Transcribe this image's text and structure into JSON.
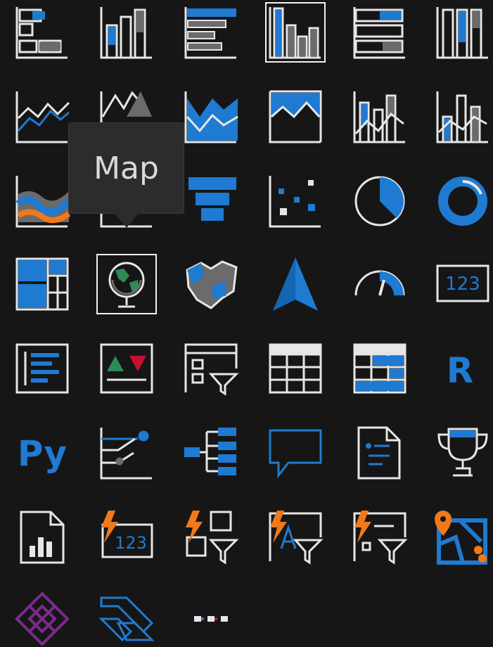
{
  "tooltip": {
    "text": "Map"
  },
  "colors": {
    "background": "#161616",
    "icon_line": "#e6e6e6",
    "accent_blue": "#1f7ad1",
    "gray": "#6b6b6b",
    "orange": "#f0791c",
    "purple": "#7b2a8c"
  },
  "visuals": [
    {
      "name": "stacked-bar-chart-icon",
      "selected": false
    },
    {
      "name": "stacked-column-chart-icon",
      "selected": false
    },
    {
      "name": "clustered-bar-chart-icon",
      "selected": false
    },
    {
      "name": "clustered-column-chart-icon",
      "selected": true
    },
    {
      "name": "100-percent-stacked-bar-chart-icon",
      "selected": false
    },
    {
      "name": "100-percent-stacked-column-chart-icon",
      "selected": false
    },
    {
      "name": "line-chart-icon",
      "selected": false
    },
    {
      "name": "area-chart-icon",
      "selected": false
    },
    {
      "name": "stacked-area-chart-icon",
      "selected": false
    },
    {
      "name": "100-percent-stacked-area-chart-icon",
      "selected": false
    },
    {
      "name": "line-and-stacked-column-chart-icon",
      "selected": false
    },
    {
      "name": "line-and-clustered-column-chart-icon",
      "selected": false
    },
    {
      "name": "ribbon-chart-icon",
      "selected": false
    },
    {
      "name": "waterfall-chart-icon",
      "selected": false
    },
    {
      "name": "funnel-chart-icon",
      "selected": false
    },
    {
      "name": "scatter-chart-icon",
      "selected": false
    },
    {
      "name": "pie-chart-icon",
      "selected": false
    },
    {
      "name": "donut-chart-icon",
      "selected": false
    },
    {
      "name": "treemap-icon",
      "selected": false
    },
    {
      "name": "map-icon",
      "selected": true
    },
    {
      "name": "filled-map-icon",
      "selected": false
    },
    {
      "name": "azure-map-icon",
      "selected": false
    },
    {
      "name": "gauge-icon",
      "selected": false
    },
    {
      "name": "card-icon",
      "selected": false
    },
    {
      "name": "multi-row-card-icon",
      "selected": false
    },
    {
      "name": "kpi-icon",
      "selected": false
    },
    {
      "name": "slicer-icon",
      "selected": false
    },
    {
      "name": "table-icon",
      "selected": false
    },
    {
      "name": "matrix-icon",
      "selected": false
    },
    {
      "name": "r-script-visual-icon",
      "selected": false
    },
    {
      "name": "python-visual-icon",
      "selected": false
    },
    {
      "name": "key-influencers-icon",
      "selected": false
    },
    {
      "name": "decomposition-tree-icon",
      "selected": false
    },
    {
      "name": "q-and-a-icon",
      "selected": false
    },
    {
      "name": "smart-narrative-icon",
      "selected": false
    },
    {
      "name": "goals-icon",
      "selected": false
    },
    {
      "name": "paginated-report-icon",
      "selected": false
    },
    {
      "name": "card-new-icon",
      "selected": false
    },
    {
      "name": "slicer-new-icon",
      "selected": false
    },
    {
      "name": "text-slicer-icon",
      "selected": false
    },
    {
      "name": "list-slicer-icon",
      "selected": false
    },
    {
      "name": "arcgis-map-icon",
      "selected": false
    },
    {
      "name": "power-apps-icon",
      "selected": false
    },
    {
      "name": "power-automate-icon",
      "selected": false
    },
    {
      "name": "more-visuals-icon",
      "selected": false
    }
  ],
  "glyph_labels": {
    "r_visual": "R",
    "python_visual": "Py",
    "card_number": "123"
  }
}
